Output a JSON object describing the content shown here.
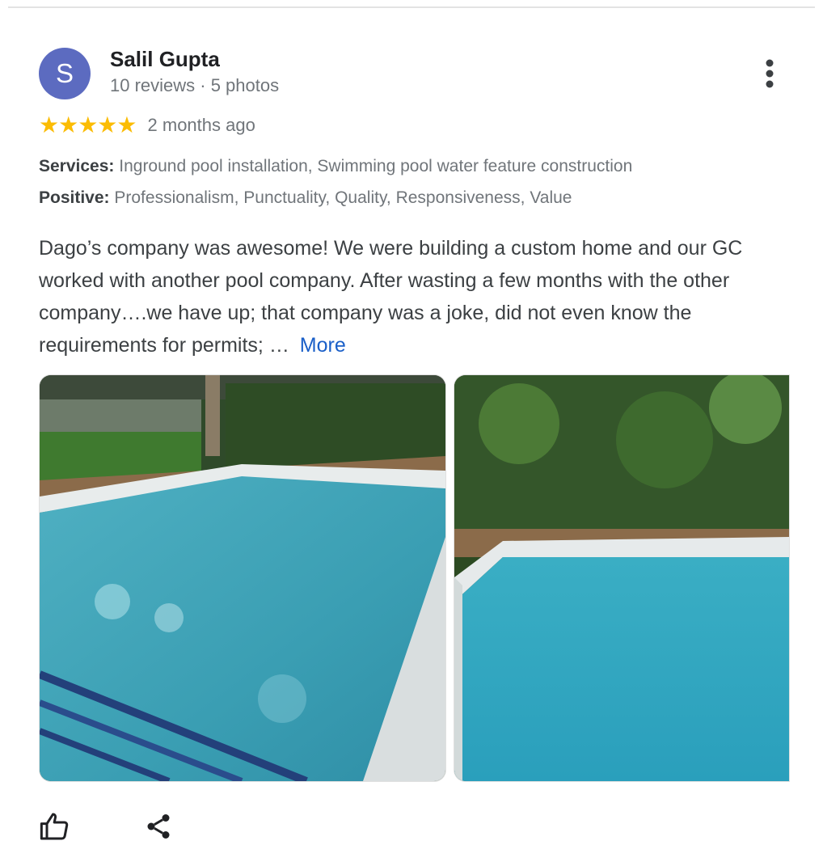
{
  "review": {
    "author": {
      "initial": "S",
      "name": "Salil Gupta",
      "meta": "10 reviews · 5 photos",
      "avatar_color": "#5c6bc0"
    },
    "rating": {
      "stars": "★★★★★",
      "value": 5,
      "max": 5,
      "time": "2 months ago",
      "star_color": "#fbbc04"
    },
    "attributes": {
      "services_label": "Services:",
      "services_value": "Inground pool installation, Swimming pool water feature construction",
      "positive_label": "Positive:",
      "positive_value": "Professionalism, Punctuality, Quality, Responsiveness, Value"
    },
    "text": "Dago’s company was awesome! We were building a custom home and our GC worked with another pool company. After wasting a few months with the other company….we have up; that company was a joke, did not even know the requirements for permits; …",
    "more_label": "More",
    "more_color": "#1a5fc8"
  },
  "icons": {
    "menu": "three-dots-vertical-icon",
    "like": "thumbs-up-icon",
    "share": "share-icon"
  }
}
